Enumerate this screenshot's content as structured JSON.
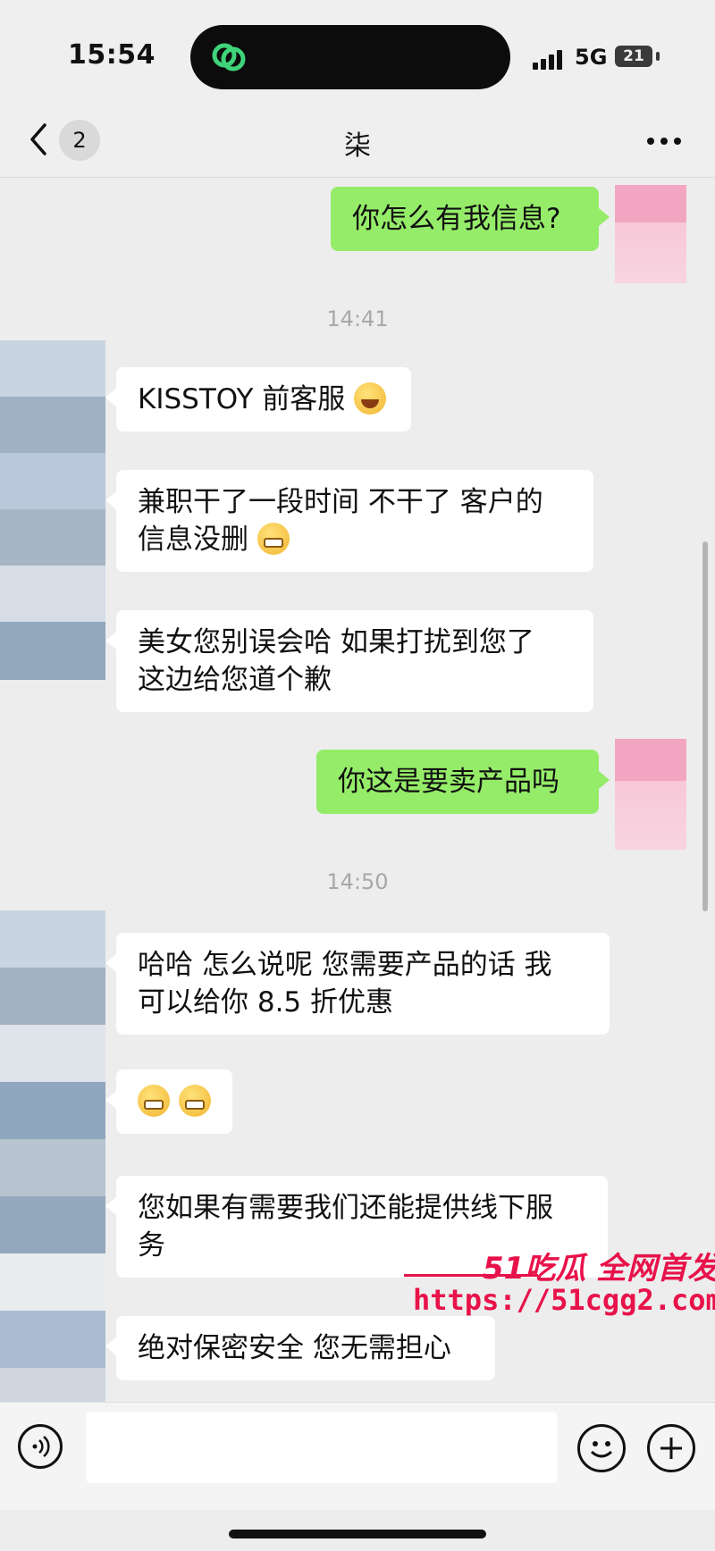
{
  "status_bar": {
    "time": "15:54",
    "network": "5G",
    "battery": "21"
  },
  "nav": {
    "unread_count": "2",
    "contact_name": "柒"
  },
  "messages": {
    "m1": "你怎么有我信息?",
    "t1": "14:41",
    "m2": "KISSTOY 前客服",
    "m3_l1": "兼职干了一段时间 不干了 客户的",
    "m3_l2": "信息没删",
    "m4_l1": "美女您别误会哈 如果打扰到您了",
    "m4_l2": "这边给您道个歉",
    "m5": "你这是要卖产品吗",
    "t2": "14:50",
    "m6_l1": "哈哈  怎么说呢 您需要产品的话 我",
    "m6_l2": "可以给你 8.5 折优惠",
    "m8_l1": "您如果有需要我们还能提供线下服",
    "m8_l2": "务",
    "m9": "绝对保密安全 您无需担心"
  },
  "watermark": {
    "brand": "51吃瓜 全网首发",
    "url": "https://51cgg2.com"
  },
  "colors": {
    "outgoing": "#95ec69",
    "incoming": "#ffffff",
    "background": "#ededed",
    "watermark": "#e8124a"
  },
  "icons": [
    "back-chevron-icon",
    "more-dots-icon",
    "voice-icon",
    "emoji-icon",
    "plus-icon",
    "app-link-icon"
  ]
}
